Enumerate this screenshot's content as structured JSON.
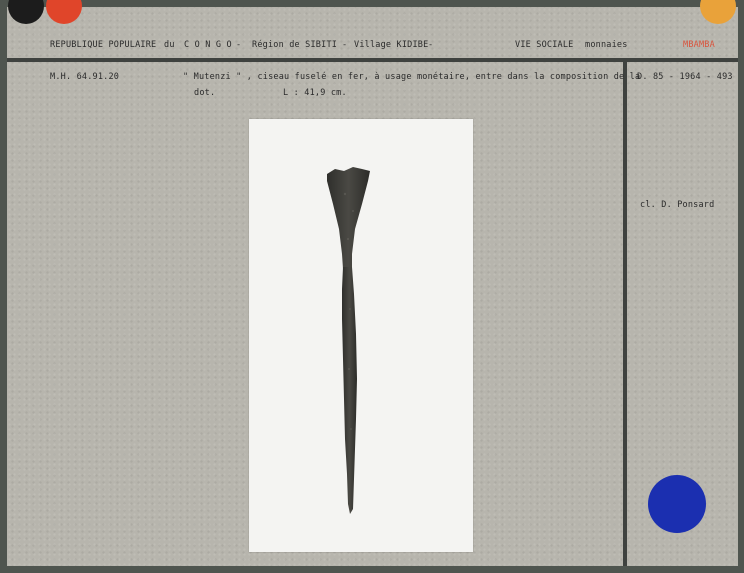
{
  "header": {
    "republic": "REPUBLIQUE POPULAIRE",
    "du": "du",
    "country": "C O N G O",
    "region_sep": "-",
    "region": "Région de SIBITI",
    "village_sep": "-",
    "village": "Village KIDIBE",
    "end_sep": "-",
    "category": "VIE SOCIALE",
    "subcategory": "monnaies",
    "ethnic_group": "MBAMBA"
  },
  "record": {
    "inventory_number": "M.H. 64.91.20",
    "description_line1": "\" Mutenzi \" , ciseau fuselé en fer, à usage monétaire, entre dans la composition de la",
    "description_line2": "dot.",
    "length": "L : 41,9 cm.",
    "photo_number": "D. 85 - 1964 - 493",
    "photographer": "cl. D. Ponsard"
  },
  "colors": {
    "black_dot": "#1c1c1c",
    "red_dot": "#e0452a",
    "orange_dot": "#e9a23a",
    "blue_dot": "#1b2fb0",
    "mbamba_text": "#d9543d"
  }
}
